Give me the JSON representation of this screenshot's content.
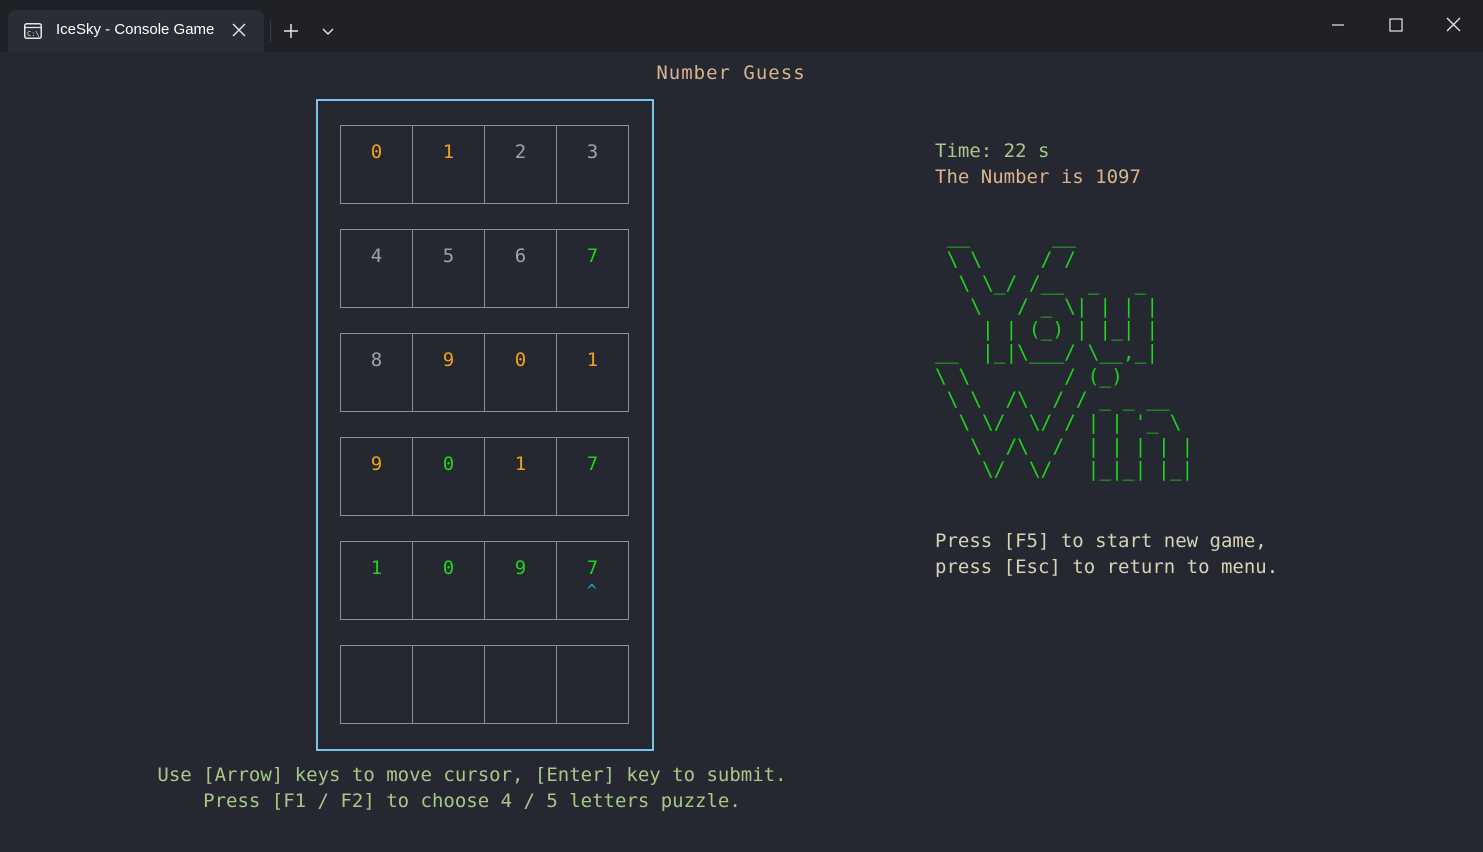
{
  "window": {
    "tab_title": "IceSky - Console Game",
    "icons": {
      "tab": "terminal-icon",
      "close_tab": "close-icon",
      "new_tab": "plus-icon",
      "dropdown": "chevron-down-icon",
      "minimize": "minimize-icon",
      "maximize": "maximize-icon",
      "close_window": "close-icon"
    }
  },
  "game": {
    "title": "Number Guess",
    "rows": [
      [
        {
          "d": "0",
          "s": "yellow"
        },
        {
          "d": "1",
          "s": "yellow"
        },
        {
          "d": "2",
          "s": "gray"
        },
        {
          "d": "3",
          "s": "gray"
        }
      ],
      [
        {
          "d": "4",
          "s": "gray"
        },
        {
          "d": "5",
          "s": "gray"
        },
        {
          "d": "6",
          "s": "gray"
        },
        {
          "d": "7",
          "s": "green"
        }
      ],
      [
        {
          "d": "8",
          "s": "gray"
        },
        {
          "d": "9",
          "s": "yellow"
        },
        {
          "d": "0",
          "s": "yellow"
        },
        {
          "d": "1",
          "s": "yellow"
        }
      ],
      [
        {
          "d": "9",
          "s": "yellow"
        },
        {
          "d": "0",
          "s": "green"
        },
        {
          "d": "1",
          "s": "yellow"
        },
        {
          "d": "7",
          "s": "green"
        }
      ],
      [
        {
          "d": "1",
          "s": "green"
        },
        {
          "d": "0",
          "s": "green"
        },
        {
          "d": "9",
          "s": "green"
        },
        {
          "d": "7",
          "s": "green"
        }
      ],
      [
        {
          "d": "",
          "s": "gray"
        },
        {
          "d": "",
          "s": "gray"
        },
        {
          "d": "",
          "s": "gray"
        },
        {
          "d": "",
          "s": "gray"
        }
      ]
    ],
    "cursor_symbol": "^",
    "cursor_row": 4,
    "cursor_col": 3,
    "time_text": "Time: 22 s",
    "number_text": "The Number is 1097",
    "win_art": " __       __\n \\ \\     / /\n  \\ \\_/ /__  _   _\n   \\   / _ \\| | | |\n    | | (_) | |_| |\n__  |_|\\___/ \\__,_|\n\\ \\        / (_)\n \\ \\  /\\  / / _ _ __\n  \\ \\/  \\/ / | | '_ \\\n   \\  /\\  /  | | | | |\n    \\/  \\/   |_|_| |_|",
    "press_line1": "Press [F5] to start new game,",
    "press_line2": "press [Esc] to return to menu.",
    "help_line1": "Use [Arrow] keys to move cursor, [Enter] key to submit.",
    "help_line2": "Press [F1 / F2] to choose 4 / 5 letters puzzle.",
    "colors": {
      "gray": "#a2a2a2",
      "yellow": "#f2a019",
      "green": "#1ed31e",
      "cursor": "#1aa3ee",
      "board_border": "#79c3f2",
      "background": "#252830"
    }
  }
}
